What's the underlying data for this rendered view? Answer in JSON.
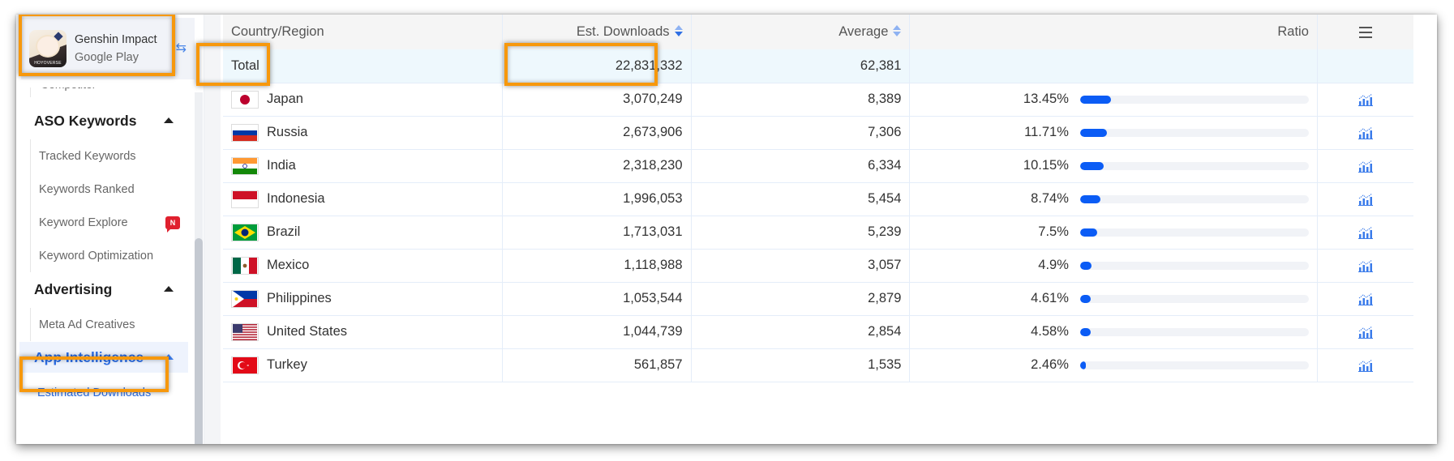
{
  "app": {
    "name": "Genshin Impact",
    "store": "Google Play",
    "icon_brand": "HOYOVERSE",
    "switch_icon": "swap-arrows-icon"
  },
  "sidebar": {
    "cut_item": "Competitor",
    "sections": [
      {
        "label": "ASO Keywords",
        "expanded": true,
        "items": [
          {
            "label": "Tracked Keywords"
          },
          {
            "label": "Keywords Ranked"
          },
          {
            "label": "Keyword Explore",
            "badge": "N"
          },
          {
            "label": "Keyword Optimization"
          }
        ]
      },
      {
        "label": "Advertising",
        "expanded": true,
        "items": [
          {
            "label": "Meta Ad Creatives"
          }
        ]
      },
      {
        "label": "App Intelligence",
        "expanded": true,
        "active": true,
        "items": [
          {
            "label": "Estimated Downloads",
            "active": true
          }
        ]
      }
    ]
  },
  "table": {
    "headers": {
      "country": "Country/Region",
      "downloads": "Est. Downloads",
      "average": "Average",
      "ratio": "Ratio",
      "menu_icon": "hamburger-menu-icon"
    },
    "total": {
      "label": "Total",
      "downloads": "22,831,332",
      "average": "62,381"
    },
    "rows": [
      {
        "country": "Japan",
        "flag": "jp",
        "downloads": "3,070,249",
        "average": "8,389",
        "ratio": "13.45%",
        "ratio_value": 13.45
      },
      {
        "country": "Russia",
        "flag": "ru",
        "downloads": "2,673,906",
        "average": "7,306",
        "ratio": "11.71%",
        "ratio_value": 11.71
      },
      {
        "country": "India",
        "flag": "in",
        "downloads": "2,318,230",
        "average": "6,334",
        "ratio": "10.15%",
        "ratio_value": 10.15
      },
      {
        "country": "Indonesia",
        "flag": "id",
        "downloads": "1,996,053",
        "average": "5,454",
        "ratio": "8.74%",
        "ratio_value": 8.74
      },
      {
        "country": "Brazil",
        "flag": "br",
        "downloads": "1,713,031",
        "average": "5,239",
        "ratio": "7.5%",
        "ratio_value": 7.5
      },
      {
        "country": "Mexico",
        "flag": "mx",
        "downloads": "1,118,988",
        "average": "3,057",
        "ratio": "4.9%",
        "ratio_value": 4.9
      },
      {
        "country": "Philippines",
        "flag": "ph",
        "downloads": "1,053,544",
        "average": "2,879",
        "ratio": "4.61%",
        "ratio_value": 4.61
      },
      {
        "country": "United States",
        "flag": "us",
        "downloads": "1,044,739",
        "average": "2,854",
        "ratio": "4.58%",
        "ratio_value": 4.58
      },
      {
        "country": "Turkey",
        "flag": "tr",
        "downloads": "561,857",
        "average": "1,535",
        "ratio": "2.46%",
        "ratio_value": 2.46
      }
    ],
    "row_action_icon": "trend-chart-icon"
  },
  "colors": {
    "accent": "#2f6fe4",
    "bar_fill": "#0b5cf5",
    "bar_track": "#f1f3f7",
    "highlight": "#f7980c",
    "total_row_bg": "#eef8fd",
    "badge_red": "#e0202e"
  }
}
